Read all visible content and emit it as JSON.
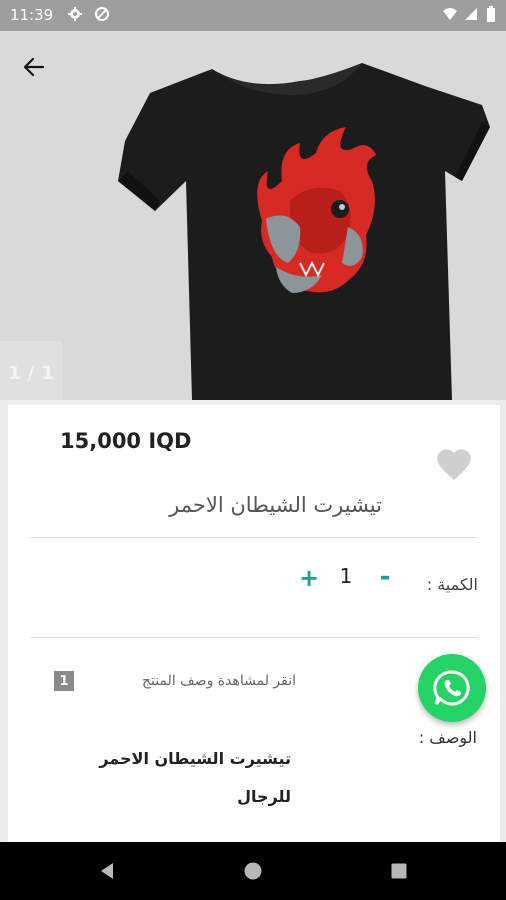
{
  "status_bar": {
    "time": "11:39",
    "icons": [
      "settings-icon",
      "data-saver-icon",
      "wifi-icon",
      "signal-icon",
      "battery-icon"
    ]
  },
  "gallery": {
    "counter": "1 / 1",
    "image": "black-tshirt-red-demon-mask-print"
  },
  "product": {
    "price": "15,000 IQD",
    "title": "تيشيرت الشيطان الاحمر",
    "favorite_icon": "heart-icon"
  },
  "quantity": {
    "label": "الكمية :",
    "value": "1",
    "minus": "-",
    "plus": "+"
  },
  "description": {
    "badge": "1",
    "toggle": "انقر لمشاهدة وصف المنتج",
    "label": "الوصف :",
    "lines": [
      "تيشيرت الشيطان الاحمر",
      "للرجال"
    ]
  },
  "colors": {
    "accent": "#1f9e95",
    "whatsapp": "#25d366",
    "status_bar": "#9e9e9e"
  }
}
